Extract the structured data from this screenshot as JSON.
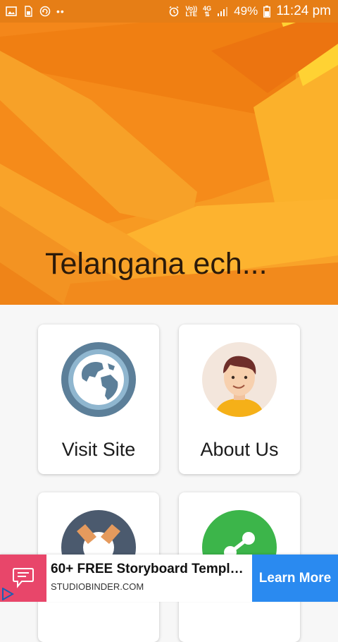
{
  "status_bar": {
    "network_top": "Vo))",
    "network_bottom": "LTE",
    "signal_top": "4G",
    "battery_percent": "49%",
    "time": "11:24 pm",
    "icons": [
      "gallery-icon",
      "sim-icon",
      "recycle-icon",
      "more-dots-icon",
      "alarm-icon",
      "signal-icon",
      "battery-icon"
    ]
  },
  "header": {
    "title": "Telangana ech..."
  },
  "cards": [
    {
      "label": "Visit Site",
      "icon": "globe-icon"
    },
    {
      "label": "About Us",
      "icon": "person-avatar-icon"
    },
    {
      "label": "",
      "icon": "lifebuoy-icon"
    },
    {
      "label": "",
      "icon": "share-icon"
    }
  ],
  "ad": {
    "headline": "60+ FREE Storyboard Template...",
    "domain": "STUDIOBINDER.COM",
    "cta": "Learn More",
    "icon": "chat-bubble-icon"
  },
  "colors": {
    "status_bar": "#e67e16",
    "header_orange": "#f7941d",
    "ad_pink": "#e8466a",
    "ad_blue": "#2a8af0"
  }
}
